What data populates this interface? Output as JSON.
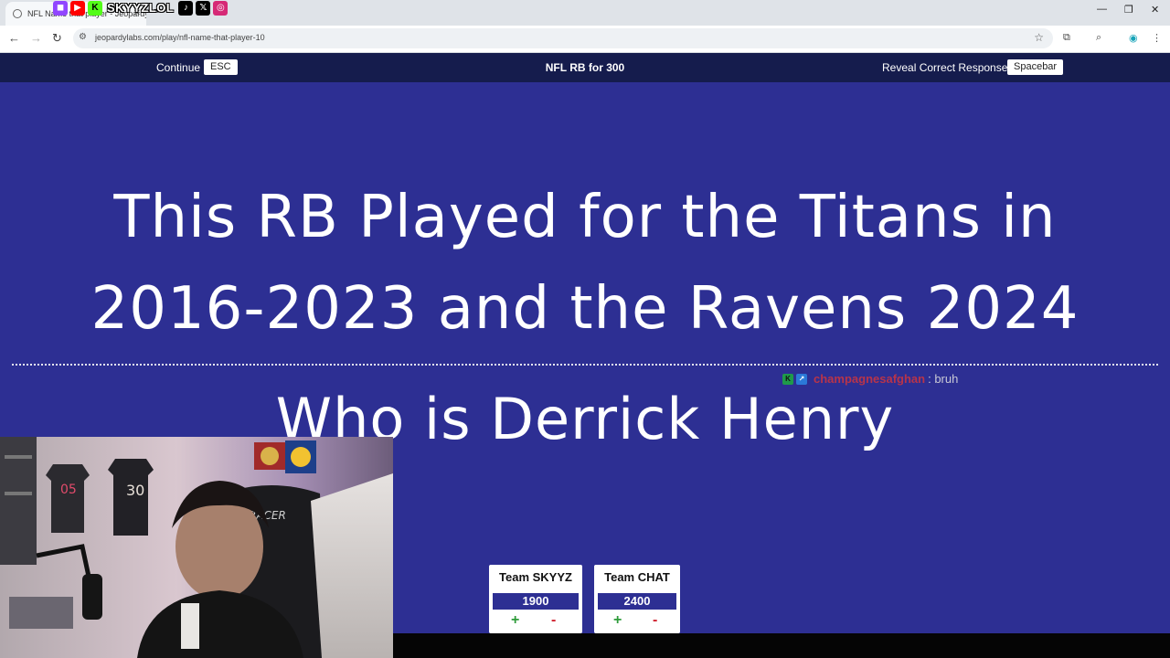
{
  "browser": {
    "tab_title": "NFL Name that player - Jeopardy",
    "url": "jeopardylabs.com/play/nfl-name-that-player-10",
    "social_handle": "SKYYZLOL"
  },
  "game": {
    "continue_label": "Continue",
    "continue_key": "ESC",
    "category_title": "NFL RB for 300",
    "reveal_label": "Reveal Correct Response",
    "reveal_key": "Spacebar",
    "question_line1": "This RB Played for the Titans in",
    "question_line2": "2016-2023 and the Ravens 2024",
    "answer": "Who is Derrick Henry"
  },
  "chat": {
    "username": "champagnesafghan",
    "message": ": bruh"
  },
  "teams": [
    {
      "name": "Team SKYYZ",
      "score": "1900",
      "plus": "+",
      "minus": "-"
    },
    {
      "name": "Team CHAT",
      "score": "2400",
      "plus": "+",
      "minus": "-"
    }
  ],
  "webcam": {
    "jersey_numbers": [
      "05",
      "30"
    ],
    "chair_brand": "RACER"
  }
}
